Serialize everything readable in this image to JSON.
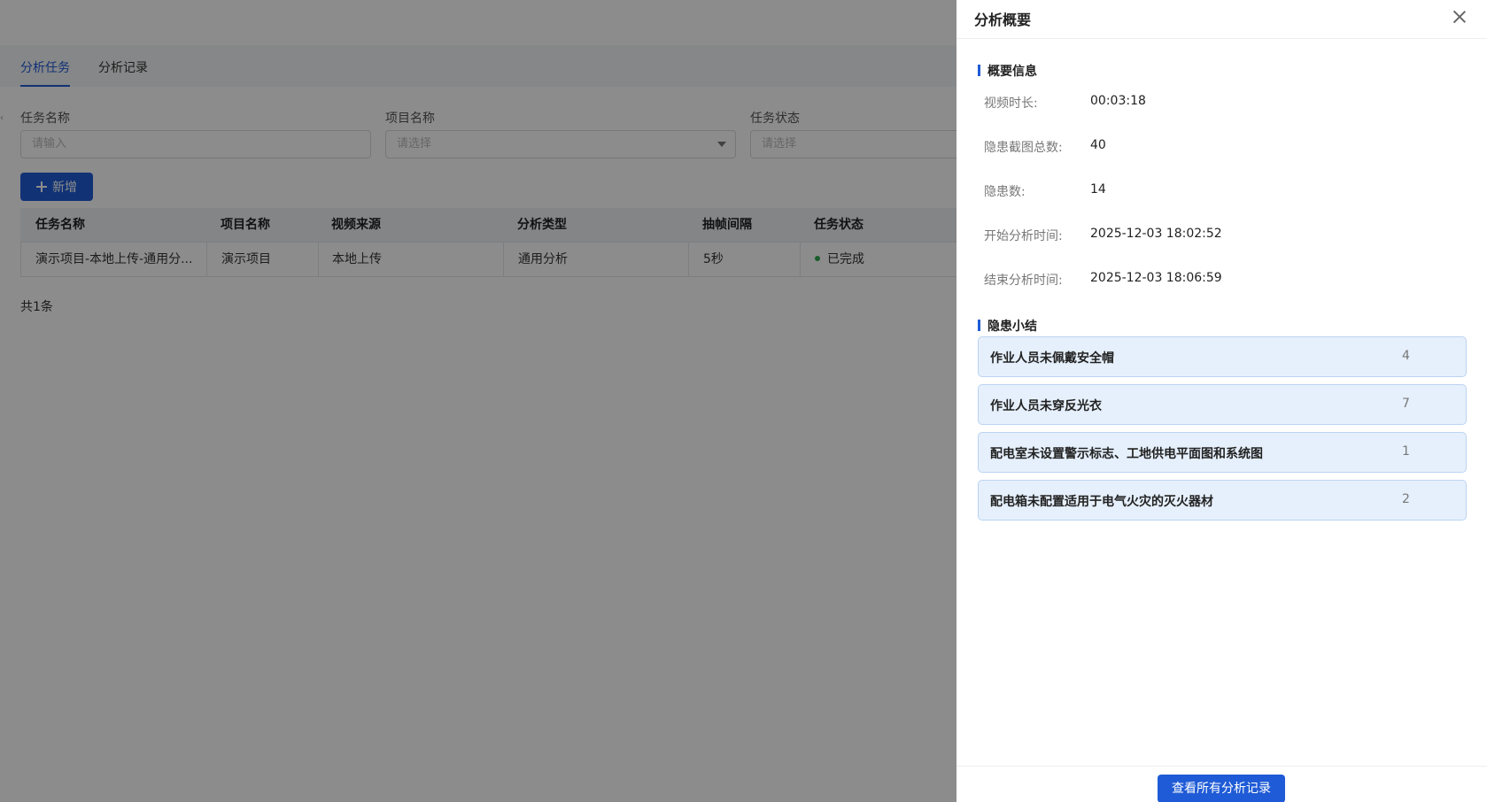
{
  "tabs": [
    {
      "label": "分析任务",
      "active": true
    },
    {
      "label": "分析记录",
      "active": false
    }
  ],
  "filters": {
    "task_name": {
      "label": "任务名称",
      "placeholder": "请输入"
    },
    "project_name": {
      "label": "项目名称",
      "placeholder": "请选择"
    },
    "task_status": {
      "label": "任务状态",
      "placeholder": "请选择"
    }
  },
  "toolbar": {
    "add_label": "新增"
  },
  "table": {
    "headers": [
      "任务名称",
      "项目名称",
      "视频来源",
      "分析类型",
      "抽帧间隔",
      "任务状态"
    ],
    "rows": [
      [
        "演示项目-本地上传-通用分...",
        "演示项目",
        "本地上传",
        "通用分析",
        "5秒",
        "已完成"
      ]
    ],
    "total": "共1条"
  },
  "drawer": {
    "title": "分析概要",
    "summary_title": "概要信息",
    "summary": [
      {
        "label": "视频时长:",
        "value": "00:03:18"
      },
      {
        "label": "隐患截图总数:",
        "value": "40"
      },
      {
        "label": "隐患数:",
        "value": "14"
      },
      {
        "label": "开始分析时间:",
        "value": "2025-12-03 18:02:52"
      },
      {
        "label": "结束分析时间:",
        "value": "2025-12-03 18:06:59"
      }
    ],
    "hazards_title": "隐患小结",
    "hazards": [
      {
        "name": "作业人员未佩戴安全帽",
        "count": "4"
      },
      {
        "name": "作业人员未穿反光衣",
        "count": "7"
      },
      {
        "name": "配电室未设置警示标志、工地供电平面图和系统图",
        "count": "1"
      },
      {
        "name": "配电箱未配置适用于电气火灾的灭火器材",
        "count": "2"
      }
    ],
    "view_all_label": "查看所有分析记录"
  },
  "colors": {
    "accent": "#1f5bd6",
    "status_done": "#2fa84f",
    "hazard_bg": "#e6f0fc"
  }
}
